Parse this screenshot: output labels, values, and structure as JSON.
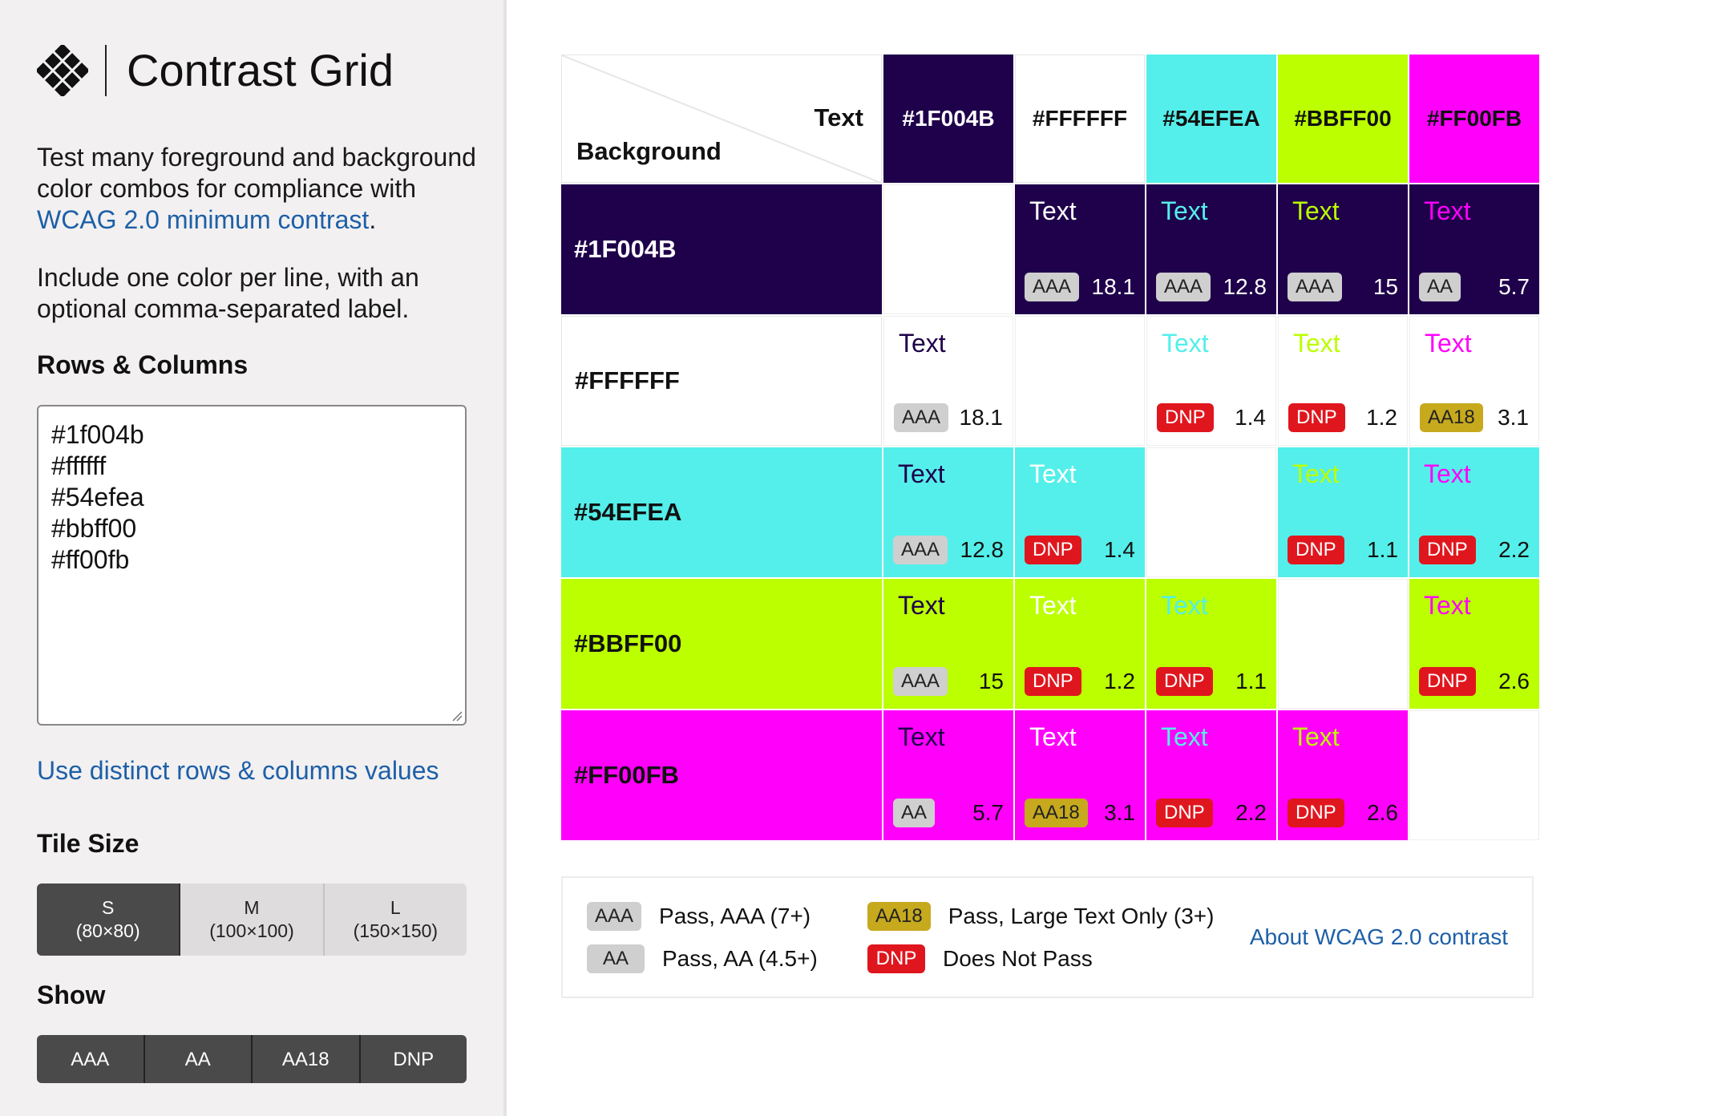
{
  "app": {
    "title": "Contrast Grid",
    "description_1": "Test many foreground and background color combos for compliance with ",
    "description_link": "WCAG 2.0 minimum contrast",
    "description_end": ".",
    "description_2": "Include one color per line, with an optional comma-separated label."
  },
  "rows_columns": {
    "heading": "Rows & Columns",
    "value": "#1f004b\n#ffffff\n#54efea\n#bbff00\n#ff00fb"
  },
  "distinct_link": "Use distinct rows & columns values",
  "tile_size": {
    "heading": "Tile Size",
    "options": [
      {
        "label": "S",
        "sub": "(80×80)",
        "active": true
      },
      {
        "label": "M",
        "sub": "(100×100)",
        "active": false
      },
      {
        "label": "L",
        "sub": "(150×150)",
        "active": false
      }
    ]
  },
  "show": {
    "heading": "Show",
    "options": [
      "AAA",
      "AA",
      "AA18",
      "DNP"
    ]
  },
  "grid": {
    "corner_text": "Text",
    "corner_background": "Background",
    "tile_text": "Text",
    "colors": [
      {
        "label": "#1F004B",
        "hex": "#1f004b",
        "head_text": "#ffffff"
      },
      {
        "label": "#FFFFFF",
        "hex": "#ffffff",
        "head_text": "#111111"
      },
      {
        "label": "#54EFEA",
        "hex": "#54efea",
        "head_text": "#111111"
      },
      {
        "label": "#BBFF00",
        "hex": "#bbff00",
        "head_text": "#111111"
      },
      {
        "label": "#FF00FB",
        "hex": "#ff00fb",
        "head_text": "#111111"
      }
    ],
    "results": [
      [
        null,
        {
          "badge": "AAA",
          "ratio": "18.1"
        },
        {
          "badge": "AAA",
          "ratio": "12.8"
        },
        {
          "badge": "AAA",
          "ratio": "15"
        },
        {
          "badge": "AA",
          "ratio": "5.7"
        }
      ],
      [
        {
          "badge": "AAA",
          "ratio": "18.1"
        },
        null,
        {
          "badge": "DNP",
          "ratio": "1.4"
        },
        {
          "badge": "DNP",
          "ratio": "1.2"
        },
        {
          "badge": "AA18",
          "ratio": "3.1"
        }
      ],
      [
        {
          "badge": "AAA",
          "ratio": "12.8"
        },
        {
          "badge": "DNP",
          "ratio": "1.4"
        },
        null,
        {
          "badge": "DNP",
          "ratio": "1.1"
        },
        {
          "badge": "DNP",
          "ratio": "2.2"
        }
      ],
      [
        {
          "badge": "AAA",
          "ratio": "15"
        },
        {
          "badge": "DNP",
          "ratio": "1.2"
        },
        {
          "badge": "DNP",
          "ratio": "1.1"
        },
        null,
        {
          "badge": "DNP",
          "ratio": "2.6"
        }
      ],
      [
        {
          "badge": "AA",
          "ratio": "5.7"
        },
        {
          "badge": "AA18",
          "ratio": "3.1"
        },
        {
          "badge": "DNP",
          "ratio": "2.2"
        },
        {
          "badge": "DNP",
          "ratio": "2.6"
        },
        null
      ]
    ]
  },
  "legend": {
    "items": [
      {
        "badge": "AAA",
        "text": "Pass, AAA (7+)"
      },
      {
        "badge": "AA",
        "text": "Pass, AA (4.5+)"
      },
      {
        "badge": "AA18",
        "text": "Pass, Large Text Only (3+)"
      },
      {
        "badge": "DNP",
        "text": "Does Not Pass"
      }
    ],
    "link": "About WCAG 2.0 contrast"
  },
  "badge_colors": {
    "AAA": "#cfcfcf",
    "AA": "#cfcfcf",
    "AA18": "#c7a91e",
    "DNP": "#e0161e"
  },
  "accent_link_color": "#1d5fa8"
}
